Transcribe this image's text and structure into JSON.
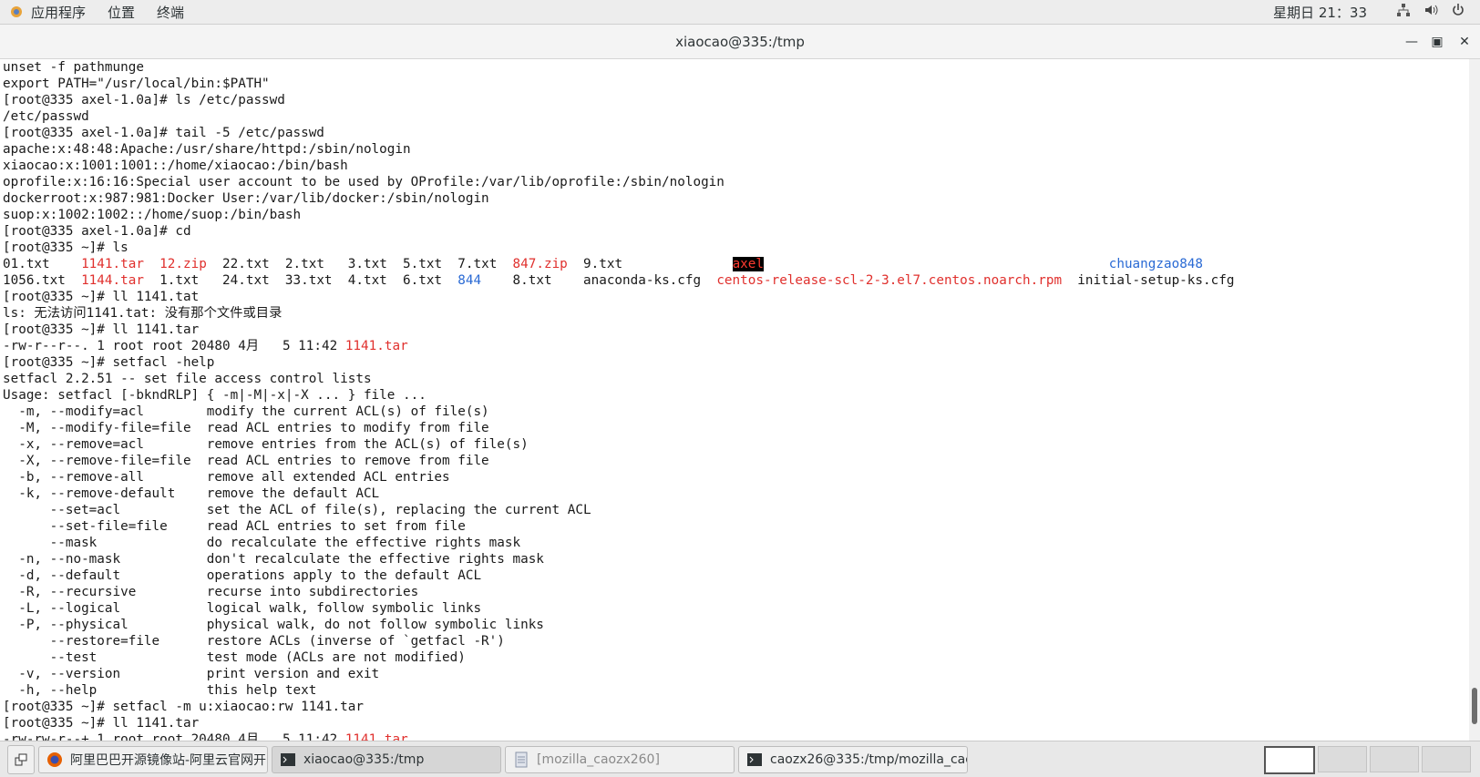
{
  "topbar": {
    "menu": [
      "应用程序",
      "位置",
      "终端"
    ],
    "clock": "星期日 21：33",
    "icons": [
      "network-icon",
      "volume-icon",
      "power-icon"
    ]
  },
  "window": {
    "title": "xiaocao@335:/tmp",
    "controls": [
      "minimize-icon",
      "maximize-icon",
      "close-icon"
    ]
  },
  "terminal": {
    "lines": [
      [
        {
          "t": "unset -f pathmunge"
        }
      ],
      [
        {
          "t": "export PATH=\"/usr/local/bin:$PATH\""
        }
      ],
      [
        {
          "t": "[root@335 axel-1.0a]# ls /etc/passwd"
        }
      ],
      [
        {
          "t": "/etc/passwd"
        }
      ],
      [
        {
          "t": "[root@335 axel-1.0a]# tail -5 /etc/passwd"
        }
      ],
      [
        {
          "t": "apache:x:48:48:Apache:/usr/share/httpd:/sbin/nologin"
        }
      ],
      [
        {
          "t": "xiaocao:x:1001:1001::/home/xiaocao:/bin/bash"
        }
      ],
      [
        {
          "t": "oprofile:x:16:16:Special user account to be used by OProfile:/var/lib/oprofile:/sbin/nologin"
        }
      ],
      [
        {
          "t": "dockerroot:x:987:981:Docker User:/var/lib/docker:/sbin/nologin"
        }
      ],
      [
        {
          "t": "suop:x:1002:1002::/home/suop:/bin/bash"
        }
      ],
      [
        {
          "t": "[root@335 axel-1.0a]# cd"
        }
      ],
      [
        {
          "t": "[root@335 ~]# ls"
        }
      ],
      [
        {
          "t": "01.txt    "
        },
        {
          "t": "1141.tar",
          "c": "red"
        },
        {
          "t": "  "
        },
        {
          "t": "12.zip",
          "c": "red"
        },
        {
          "t": "  22.txt  2.txt   3.txt  5.txt  7.txt  "
        },
        {
          "t": "847.zip",
          "c": "red"
        },
        {
          "t": "  9.txt              "
        },
        {
          "t": "axel",
          "c": "hl"
        },
        {
          "t": "                                            "
        },
        {
          "t": "chuangzao848",
          "c": "blue"
        }
      ],
      [
        {
          "t": "1056.txt  "
        },
        {
          "t": "1144.tar",
          "c": "red"
        },
        {
          "t": "  1.txt   24.txt  33.txt  4.txt  6.txt  "
        },
        {
          "t": "844",
          "c": "blue"
        },
        {
          "t": "    8.txt    anaconda-ks.cfg  "
        },
        {
          "t": "centos-release-scl-2-3.el7.centos.noarch.rpm",
          "c": "red"
        },
        {
          "t": "  initial-setup-ks.cfg"
        }
      ],
      [
        {
          "t": "[root@335 ~]# ll 1141.tat"
        }
      ],
      [
        {
          "t": "ls: 无法访问1141.tat: 没有那个文件或目录"
        }
      ],
      [
        {
          "t": "[root@335 ~]# ll 1141.tar"
        }
      ],
      [
        {
          "t": "-rw-r--r--. 1 root root 20480 4月   5 11:42 "
        },
        {
          "t": "1141.tar",
          "c": "red"
        }
      ],
      [
        {
          "t": "[root@335 ~]# setfacl -help"
        }
      ],
      [
        {
          "t": "setfacl 2.2.51 -- set file access control lists"
        }
      ],
      [
        {
          "t": "Usage: setfacl [-bkndRLP] { -m|-M|-x|-X ... } file ..."
        }
      ],
      [
        {
          "t": "  -m, --modify=acl        modify the current ACL(s) of file(s)"
        }
      ],
      [
        {
          "t": "  -M, --modify-file=file  read ACL entries to modify from file"
        }
      ],
      [
        {
          "t": "  -x, --remove=acl        remove entries from the ACL(s) of file(s)"
        }
      ],
      [
        {
          "t": "  -X, --remove-file=file  read ACL entries to remove from file"
        }
      ],
      [
        {
          "t": "  -b, --remove-all        remove all extended ACL entries"
        }
      ],
      [
        {
          "t": "  -k, --remove-default    remove the default ACL"
        }
      ],
      [
        {
          "t": "      --set=acl           set the ACL of file(s), replacing the current ACL"
        }
      ],
      [
        {
          "t": "      --set-file=file     read ACL entries to set from file"
        }
      ],
      [
        {
          "t": "      --mask              do recalculate the effective rights mask"
        }
      ],
      [
        {
          "t": "  -n, --no-mask           don't recalculate the effective rights mask"
        }
      ],
      [
        {
          "t": "  -d, --default           operations apply to the default ACL"
        }
      ],
      [
        {
          "t": "  -R, --recursive         recurse into subdirectories"
        }
      ],
      [
        {
          "t": "  -L, --logical           logical walk, follow symbolic links"
        }
      ],
      [
        {
          "t": "  -P, --physical          physical walk, do not follow symbolic links"
        }
      ],
      [
        {
          "t": "      --restore=file      restore ACLs (inverse of `getfacl -R')"
        }
      ],
      [
        {
          "t": "      --test              test mode (ACLs are not modified)"
        }
      ],
      [
        {
          "t": "  -v, --version           print version and exit"
        }
      ],
      [
        {
          "t": "  -h, --help              this help text"
        }
      ],
      [
        {
          "t": "[root@335 ~]# setfacl -m u:xiaocao:rw 1141.tar"
        }
      ],
      [
        {
          "t": "[root@335 ~]# ll 1141.tar"
        }
      ],
      [
        {
          "t": "-rw-rw-r--+ 1 root root 20480 4月   5 11:42 "
        },
        {
          "t": "1141.tar",
          "c": "red"
        }
      ]
    ]
  },
  "taskbar": {
    "tasks": [
      {
        "label": "阿里巴巴开源镜像站-阿里云官网开...",
        "icon": "firefox-icon",
        "state": "normal"
      },
      {
        "label": "xiaocao@335:/tmp",
        "icon": "terminal-icon",
        "state": "active"
      },
      {
        "label": "[mozilla_caozx260]",
        "icon": "file-icon",
        "state": "dim"
      },
      {
        "label": "caozx26@335:/tmp/mozilla_caozx···",
        "icon": "terminal-icon",
        "state": "normal"
      }
    ],
    "workspaces": 4,
    "current_workspace": 1
  },
  "colors": {
    "archive": "#e0302d",
    "directory": "#2a6ad4"
  }
}
